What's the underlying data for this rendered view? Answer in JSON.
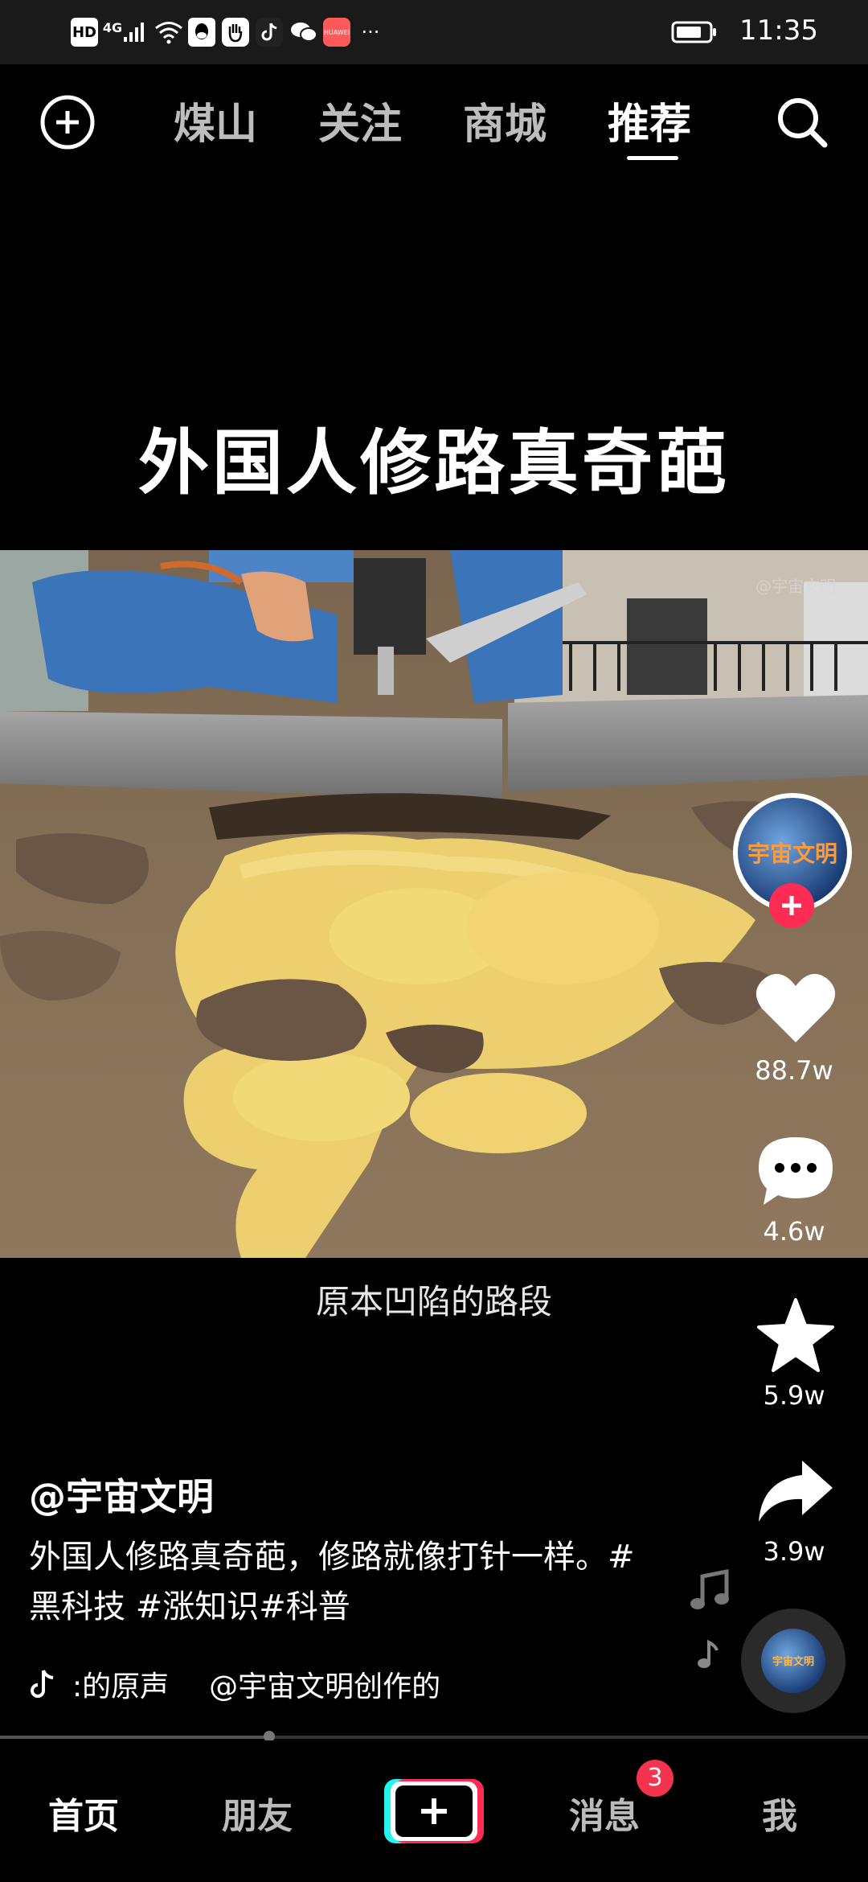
{
  "status_bar": {
    "left_icons": [
      "HD",
      "4G",
      "signal-icon",
      "wifi-icon",
      "qq-icon",
      "hand-icon",
      "tiktok-icon",
      "wechat-icon",
      "huawei-icon",
      "more-dots-icon"
    ],
    "hd": "HD",
    "network": "4G",
    "huawei": "HUAWEI",
    "dots": "···",
    "time": "11:35"
  },
  "top_nav": {
    "tabs": [
      {
        "label": "煤山"
      },
      {
        "label": "关注"
      },
      {
        "label": "商城"
      },
      {
        "label": "推荐"
      }
    ],
    "active_index": 3
  },
  "video": {
    "title_caption": "外国人修路真奇葩",
    "watermark": "@宇宙文明",
    "subtitle": "原本凹陷的路段"
  },
  "right_rail": {
    "avatar_text": "宇宙文明",
    "likes": "88.7w",
    "comments": "4.6w",
    "favorites": "5.9w",
    "shares": "3.9w",
    "disc_text": "宇宙文明"
  },
  "post": {
    "author": "@宇宙文明",
    "description": "外国人修路真奇葩，修路就像打针一样。#黑科技 #涨知识#科普",
    "music_label": ":的原声",
    "music_credit": "@宇宙文明创作的",
    "progress": 0.31
  },
  "bottom_tabs": {
    "home": "首页",
    "friends": "朋友",
    "messages": "消息",
    "messages_badge": "3",
    "me": "我"
  },
  "colors": {
    "accent_red": "#fe2c55",
    "badge_red": "#f4344f",
    "cyan": "#25f4ee"
  }
}
